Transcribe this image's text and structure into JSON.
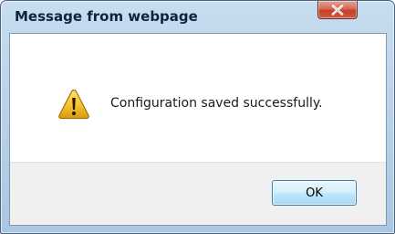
{
  "window": {
    "title": "Message from webpage",
    "close_icon": "close-icon"
  },
  "dialog": {
    "icon": "warning-icon",
    "message": "Configuration saved successfully.",
    "ok_label": "OK"
  },
  "colors": {
    "titlebar": "#b9d3ea",
    "close_button": "#c84b33",
    "warning_yellow": "#f2c42c",
    "ok_button_border": "#3c7fb1"
  }
}
